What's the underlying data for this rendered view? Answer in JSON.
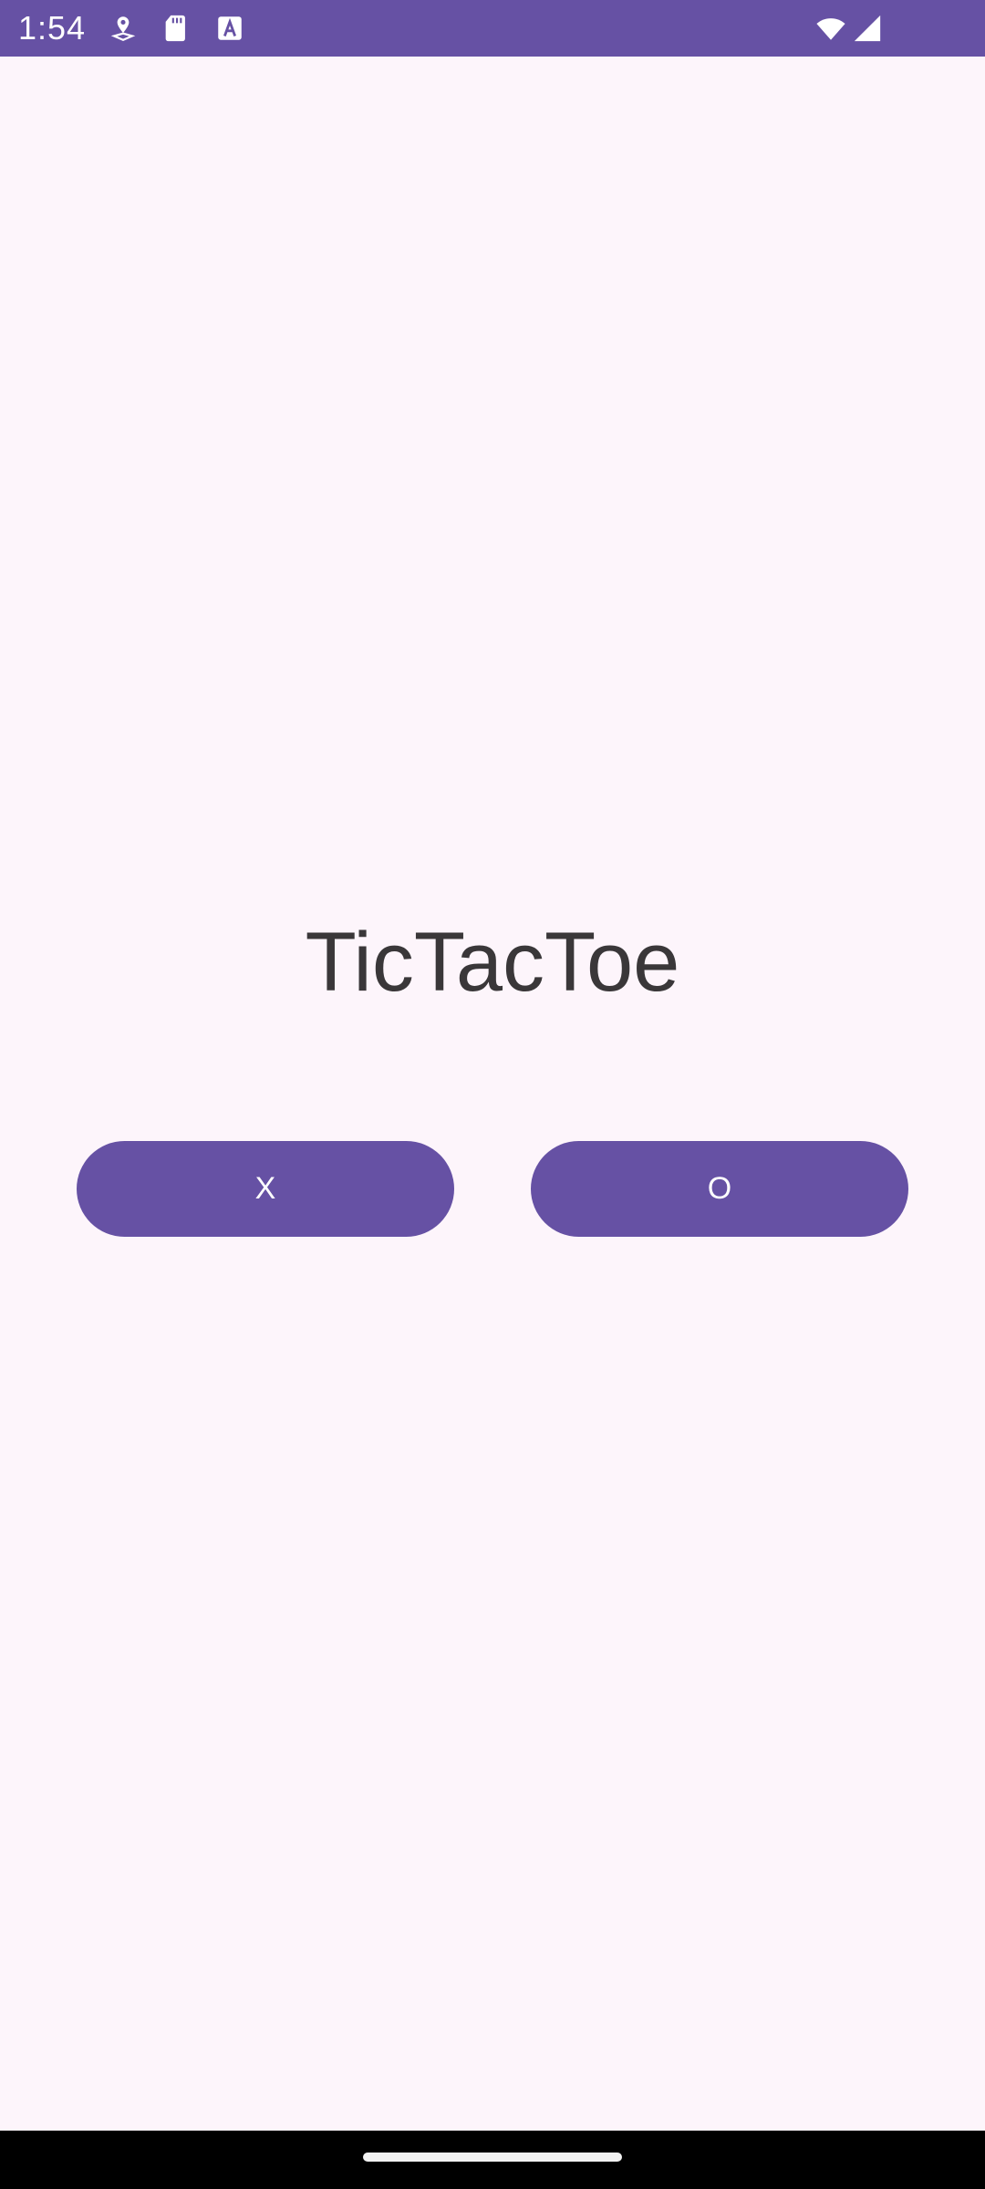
{
  "status_bar": {
    "time": "1:54",
    "bg_color": "#6651a4",
    "icons": [
      "location-pin-icon",
      "sd-card-icon",
      "font-a-icon",
      "wifi-icon",
      "signal-icon"
    ]
  },
  "main": {
    "title": "TicTacToe",
    "buttons": {
      "x_label": "X",
      "o_label": "O"
    },
    "accent_color": "#6651a4",
    "background_color": "#fdf5fb"
  },
  "nav_bar": {
    "handle": "gesture-handle"
  }
}
